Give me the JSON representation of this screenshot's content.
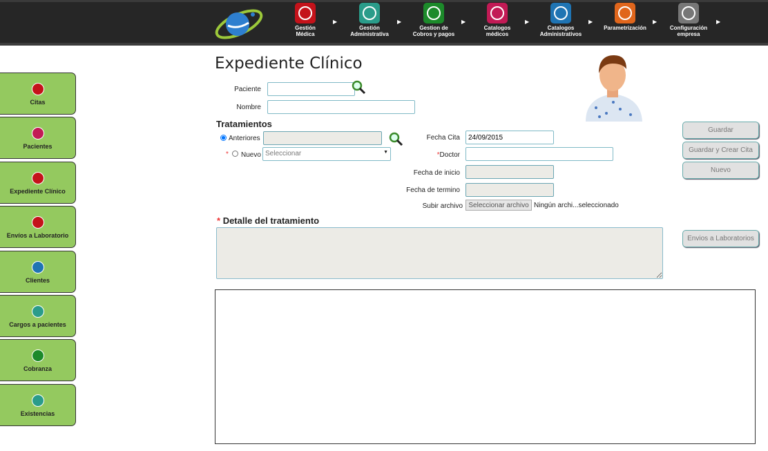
{
  "nav": [
    {
      "label1": "Gestión",
      "label2": "Médica",
      "color": "#c4121a"
    },
    {
      "label1": "Gestión",
      "label2": "Administrativa",
      "color": "#2a9c8a"
    },
    {
      "label1": "Gestion de",
      "label2": "Cobros y pagos",
      "color": "#1c8a2a"
    },
    {
      "label1": "Catalogos",
      "label2": "médicos",
      "color": "#c21a55"
    },
    {
      "label1": "Catalogos",
      "label2": "Administrativos",
      "color": "#1f74b3"
    },
    {
      "label1": "Parametrización",
      "label2": "",
      "color": "#e0661c"
    },
    {
      "label1": "Configuración",
      "label2": "empresa",
      "color": "#777777"
    }
  ],
  "sidebar": [
    {
      "label": "Citas",
      "color": "#c4121a"
    },
    {
      "label": "Pacientes",
      "color": "#c21a55"
    },
    {
      "label": "Expediente Clínico",
      "color": "#c4121a"
    },
    {
      "label": "Envíos a Laboratorio",
      "color": "#c4121a"
    },
    {
      "label": "Clientes",
      "color": "#1f74b3"
    },
    {
      "label": "Cargos a pacientes",
      "color": "#2a9c8a"
    },
    {
      "label": "Cobranza",
      "color": "#1c8a2a"
    },
    {
      "label": "Existencias",
      "color": "#2a9c8a"
    }
  ],
  "page": {
    "title": "Expediente Clínico"
  },
  "form": {
    "paciente_label": "Paciente",
    "paciente_value": "",
    "nombre_label": "Nombre",
    "nombre_value": "",
    "tratamientos_title": "Tratamientos",
    "anteriores_label": "Anteriores",
    "nuevo_label": "Nuevo",
    "nuevo_select": "Seleccionar",
    "fecha_cita_label": "Fecha Cita",
    "fecha_cita_value": "24/09/2015",
    "doctor_label": "Doctor",
    "fecha_inicio_label": "Fecha de inicio",
    "fecha_termino_label": "Fecha de termino",
    "subir_label": "Subir archivo",
    "file_button": "Seleccionar archivo",
    "file_status": "Ningún archi...seleccionado",
    "detalle_title": "Detalle del tratamiento",
    "required": "*"
  },
  "buttons": {
    "guardar": "Guardar",
    "guardar_cita": "Guardar y Crear Cita",
    "nuevo": "Nuevo",
    "envios": "Envios a Laboratorios"
  }
}
